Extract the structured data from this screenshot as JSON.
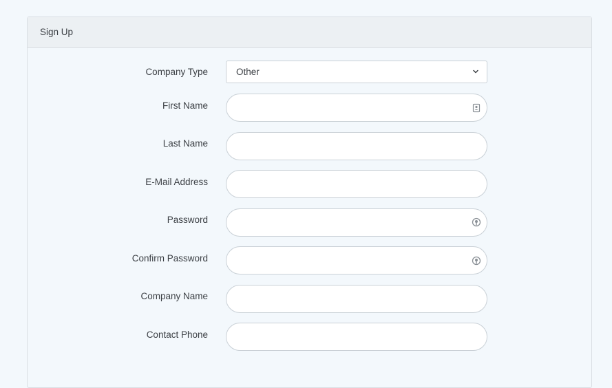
{
  "form": {
    "title": "Sign Up",
    "company_type": {
      "label": "Company Type",
      "selected": "Other"
    },
    "fields": [
      {
        "label": "First Name",
        "value": "",
        "icon": "contact-card-icon"
      },
      {
        "label": "Last Name",
        "value": ""
      },
      {
        "label": "E-Mail Address",
        "value": ""
      },
      {
        "label": "Password",
        "value": "",
        "icon": "password-key-icon"
      },
      {
        "label": "Confirm Password",
        "value": "",
        "icon": "password-key-icon"
      },
      {
        "label": "Company Name",
        "value": ""
      },
      {
        "label": "Contact Phone",
        "value": ""
      }
    ]
  },
  "colors": {
    "page_background": "#f3f8fc",
    "header_background": "#ecf0f3",
    "border": "#c9d0d6",
    "text": "#3b3f44"
  }
}
